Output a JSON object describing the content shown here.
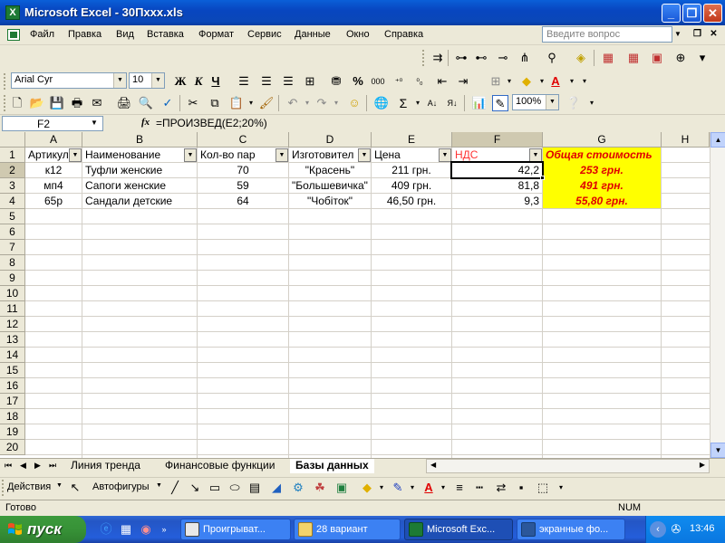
{
  "window": {
    "title": "Microsoft Excel - 30Пxxx.xls"
  },
  "menu": [
    "Файл",
    "Правка",
    "Вид",
    "Вставка",
    "Формат",
    "Сервис",
    "Данные",
    "Окно",
    "Справка"
  ],
  "help_box": {
    "placeholder": "Введите вопрос"
  },
  "format_toolbar": {
    "font": "Arial Cyr",
    "size": "10",
    "bold": "Ж",
    "italic": "К",
    "underline": "Ч",
    "percent": "%",
    "thousands": "000"
  },
  "standard_toolbar": {
    "zoom": "100%",
    "sigma": "Σ"
  },
  "formula_bar": {
    "name_box": "F2",
    "fx": "fx",
    "formula": "=ПРОИЗВЕД(E2;20%)"
  },
  "columns": [
    "A",
    "B",
    "C",
    "D",
    "E",
    "F",
    "G",
    "H"
  ],
  "rows": [
    "1",
    "2",
    "3",
    "4",
    "5",
    "6",
    "7",
    "8",
    "9",
    "10",
    "11",
    "12",
    "13",
    "14",
    "15",
    "16",
    "17",
    "18",
    "19",
    "20"
  ],
  "table": {
    "headers": [
      "Артикул",
      "Наименование",
      "Кол-во пар",
      "Изготовител",
      "Цена",
      "НДС",
      "Общая стоимость"
    ],
    "rows": [
      [
        "к12",
        "Туфли женские",
        "70",
        "\"Красень\"",
        "211 грн.",
        "42,2",
        "253 грн."
      ],
      [
        "мп4",
        "Сапоги женские",
        "59",
        "\"Большевичка\"",
        "409 грн.",
        "81,8",
        "491 грн."
      ],
      [
        "65р",
        "Сандали детские",
        "64",
        "\"Чобіток\"",
        "46,50 грн.",
        "9,3",
        "55,80 грн."
      ]
    ]
  },
  "sheet_tabs": [
    "Линия тренда",
    "Финансовые функции",
    "Базы данных"
  ],
  "draw_toolbar": {
    "actions": "Действия",
    "autoshapes": "Автофигуры"
  },
  "status": {
    "ready": "Готово",
    "num": "NUM"
  },
  "taskbar": {
    "start": "пуск",
    "buttons": [
      "Проигрыват...",
      "28 вариант",
      "Microsoft Exc...",
      "экранные фо..."
    ],
    "clock": "13:46"
  },
  "colors": {
    "yellow": "#ffff00",
    "red": "#e00000",
    "ndc_header": "#ff3333"
  }
}
